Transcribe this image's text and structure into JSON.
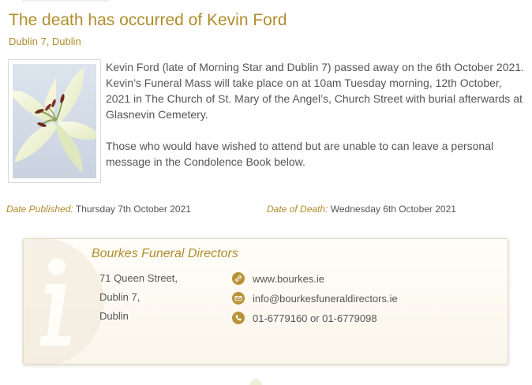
{
  "notice": {
    "title": "The death has occurred of Kevin Ford",
    "location": "Dublin 7, Dublin",
    "paragraphs": [
      "Kevin Ford (late of Morning Star and Dublin 7) passed away on the 6th October 2021. Kevin’s Funeral Mass will take place on at 10am Tuesday morning, 12th October, 2021 in The Church of St. Mary of the Angel’s, Church Street with burial afterwards at Glasnevin Cemetery.",
      "Those who would have wished to attend but are unable to can leave a personal message in the Condolence Book below."
    ],
    "date_published_label": "Date Published:",
    "date_published": "Thursday 7th October 2021",
    "date_of_death_label": "Date of Death:",
    "date_of_death": "Wednesday 6th October 2021"
  },
  "director": {
    "name": "Bourkes Funeral Directors",
    "address": [
      "71 Queen Street,",
      "Dublin 7,",
      "Dublin"
    ],
    "website": "www.bourkes.ie",
    "email": "info@bourkesfuneraldirectors.ie",
    "phone": "01-6779160 or 01-6779098"
  },
  "colors": {
    "accent": "#b08d2c",
    "icon_bg": "#b89237",
    "text": "#555555",
    "card_border": "#e8d9bf"
  },
  "icons": {
    "website": "link-icon",
    "email": "envelope-icon",
    "phone": "phone-icon",
    "watermark": "info-icon"
  }
}
